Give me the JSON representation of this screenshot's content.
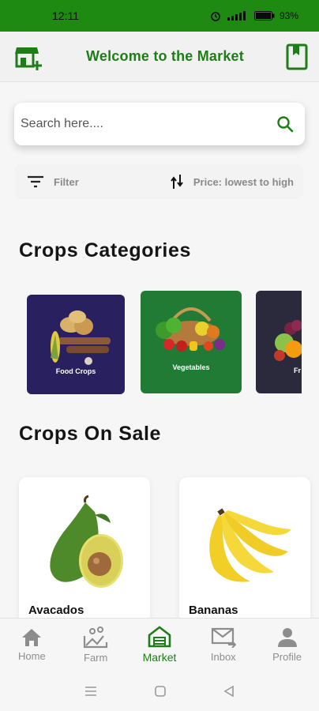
{
  "status_bar": {
    "time": "12:11",
    "battery": "93%"
  },
  "header": {
    "title": "Welcome to the Market"
  },
  "search": {
    "placeholder": "Search here...."
  },
  "filters": {
    "filter_label": "Filter",
    "sort_label": "Price: lowest to high"
  },
  "categories_section": {
    "title": "Crops Categories",
    "items": [
      {
        "label": "Food Crops",
        "bg": "#28205f"
      },
      {
        "label": "Vegetables",
        "bg": "#217b34"
      },
      {
        "label": "Fr",
        "bg": "#2a2a3c"
      }
    ]
  },
  "sale_section": {
    "title": "Crops On Sale",
    "items": [
      {
        "name": "Avacados"
      },
      {
        "name": "Bananas"
      }
    ]
  },
  "bottom_nav": {
    "items": [
      {
        "label": "Home",
        "icon": "home-icon"
      },
      {
        "label": "Farm",
        "icon": "farm-icon"
      },
      {
        "label": "Market",
        "icon": "market-icon",
        "active": true
      },
      {
        "label": "Inbox",
        "icon": "inbox-icon"
      },
      {
        "label": "Profile",
        "icon": "profile-icon"
      }
    ]
  },
  "colors": {
    "brand_green": "#1f7d17",
    "status_green": "#1f8a12"
  }
}
